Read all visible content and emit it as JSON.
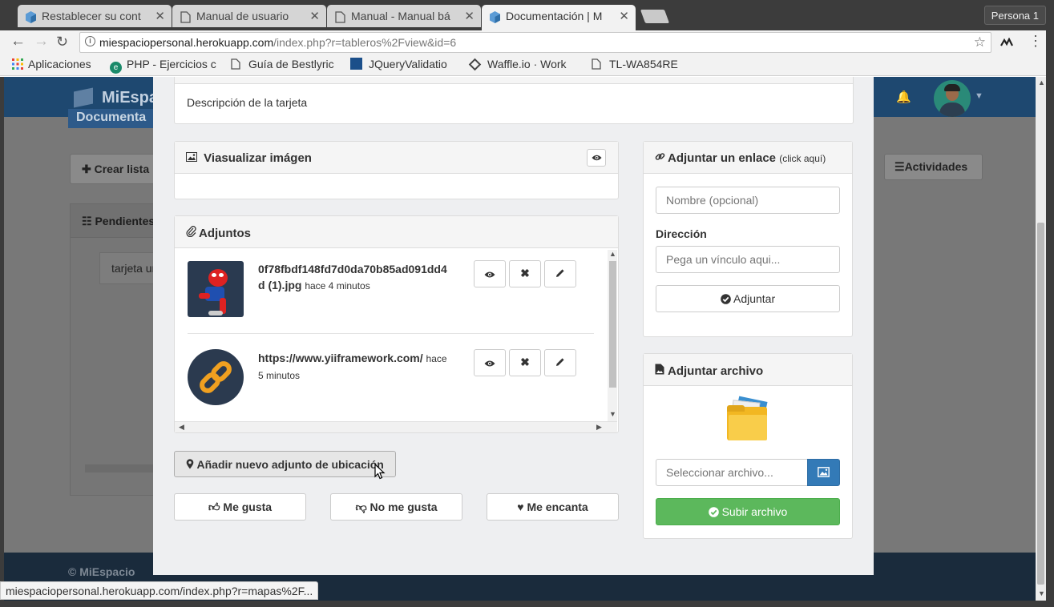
{
  "browser": {
    "tabs": [
      {
        "label": "Restablecer su cont"
      },
      {
        "label": "Manual de usuario"
      },
      {
        "label": "Manual - Manual bá"
      },
      {
        "label": "Documentación | M"
      }
    ],
    "profile": "Persona 1",
    "url_host": "miespaciopersonal.herokuapp.com",
    "url_path": "/index.php?r=tableros%2Fview&id=6",
    "bookmarks": [
      {
        "label": "Aplicaciones"
      },
      {
        "label": "PHP - Ejercicios c"
      },
      {
        "label": "Guía de Bestlyric"
      },
      {
        "label": "JQueryValidatio"
      },
      {
        "label": "Waffle.io · Work"
      },
      {
        "label": "TL-WA854RE"
      }
    ],
    "status_url": "miespaciopersonal.herokuapp.com/index.php?r=mapas%2F..."
  },
  "background": {
    "brand": "MiEspa",
    "doc_tab": "Documenta",
    "crear_lista": "Crear lista",
    "actividades": "Actividades",
    "pendientes": "Pendientes",
    "card": "tarjeta un",
    "footer": "© MiEspacio"
  },
  "modal": {
    "description": "Descripción de la tarjeta",
    "visualizar": {
      "title": "Viasualizar imágen"
    },
    "adjuntos": {
      "title": "Adjuntos",
      "items": [
        {
          "name": "0f78fbdf148fd7d0da70b85ad091dd4",
          "name2": "d (1).jpg",
          "time": "hace 4 minutos",
          "thumb": "spiderman-image"
        },
        {
          "name": "https://www.yiiframework.com/",
          "time_a": "hace",
          "time_b": "5 minutos",
          "thumb": "link-icon"
        }
      ]
    },
    "ubicacion_button": "Añadir nuevo adjunto de ubicación",
    "reactions": [
      {
        "label": "Me gusta",
        "icon": "thumbs-up-icon"
      },
      {
        "label": "No me gusta",
        "icon": "thumbs-down-icon"
      },
      {
        "label": "Me encanta",
        "icon": "heart-icon"
      }
    ],
    "enlace": {
      "title": "Adjuntar un enlace",
      "note": "(click aquí)",
      "name_placeholder": "Nombre (opcional)",
      "direccion_label": "Dirección",
      "url_placeholder": "Pega un vínculo aqui...",
      "submit": "Adjuntar"
    },
    "archivo": {
      "title": "Adjuntar archivo",
      "file_placeholder": "Seleccionar archivo...",
      "submit": "Subir archivo"
    }
  },
  "colors": {
    "navbar": "#1e4870",
    "success": "#5cb85c",
    "primary": "#337ab7"
  }
}
